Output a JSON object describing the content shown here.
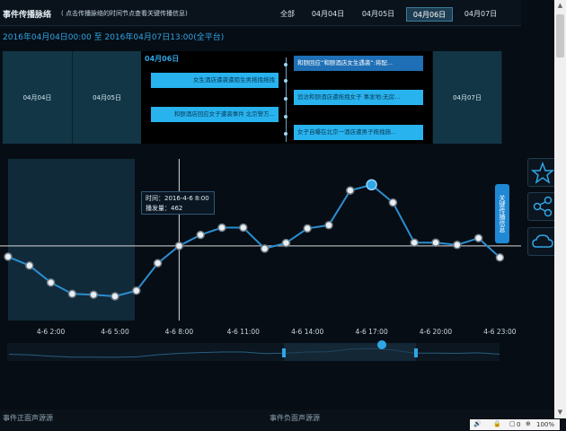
{
  "header": {
    "title": "事件传播脉络",
    "hint": "( 点击传播脉络的时间节点查看关键传播信息)",
    "tabs": [
      {
        "label": "全部"
      },
      {
        "label": "04月04日"
      },
      {
        "label": "04月05日"
      },
      {
        "label": "04月06日",
        "active": true
      },
      {
        "label": "04月07日"
      }
    ],
    "range": "2016年04月04日00:00 至 2016年04月07日13:00(全平台)"
  },
  "timeline": {
    "day_left1": "04月04日",
    "day_left2": "04月05日",
    "day_current": "04月06日",
    "day_right": "04月07日",
    "left_cards": [
      "女生酒店遭袭遭陌生男拖拽拖拽",
      "和颐酒店回应女子遭袭事件 北京警方..."
    ],
    "right_cards": [
      "和颐回应“和颐酒店女生遇袭”:将配...",
      "追访和颐酒店遭拖拽女子 事发地:无房...",
      "女子自曝在北京一酒店遭男子拖拽施..."
    ]
  },
  "chart_data": {
    "type": "line",
    "title": "",
    "xlabel": "",
    "ylabel": "",
    "x": [
      "4-6 0:00",
      "4-6 1:00",
      "4-6 2:00",
      "4-6 3:00",
      "4-6 4:00",
      "4-6 5:00",
      "4-6 6:00",
      "4-6 7:00",
      "4-6 8:00",
      "4-6 9:00",
      "4-6 10:00",
      "4-6 11:00",
      "4-6 12:00",
      "4-6 13:00",
      "4-6 14:00",
      "4-6 15:00",
      "4-6 16:00",
      "4-6 17:00",
      "4-6 18:00",
      "4-6 19:00",
      "4-6 20:00",
      "4-6 21:00",
      "4-6 22:00",
      "4-6 23:00"
    ],
    "xtick_labels": [
      "4-6 2:00",
      "4-6 5:00",
      "4-6 8:00",
      "4-6 11:00",
      "4-6 14:00",
      "4-6 17:00",
      "4-6 20:00",
      "4-6 23:00"
    ],
    "values": [
      395,
      340,
      235,
      165,
      160,
      150,
      185,
      355,
      462,
      530,
      575,
      575,
      445,
      480,
      570,
      590,
      805,
      840,
      730,
      482,
      482,
      468,
      510,
      390
    ],
    "ylim": [
      0,
      1000
    ],
    "highlight_index": 8,
    "accent_color": "#2fa6e6",
    "tooltip": {
      "time_label": "时间：2016-4-6 8:00",
      "count_label": "播发量：462"
    }
  },
  "side": {
    "key_tab": "关键传播信息",
    "icons": [
      "star-icon",
      "share-icon",
      "cloud-icon"
    ]
  },
  "bottom": {
    "section1": "事件正面声源源",
    "section2": "事件负面声源源",
    "zoom": "100%",
    "status_count": "0"
  }
}
